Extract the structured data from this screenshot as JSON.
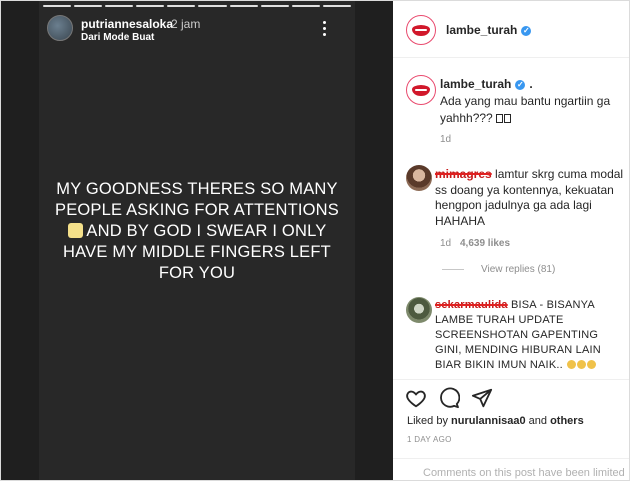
{
  "story": {
    "username": "putriannesaloka",
    "time": "2 jam",
    "subtitle": "Dari Mode Buat",
    "text_before": "MY GOODNESS THERES SO MANY PEOPLE ASKING FOR ATTENTIONS ",
    "text_after": " AND BY GOD I SWEAR I ONLY HAVE MY MIDDLE FINGERS LEFT FOR YOU",
    "emoji_icon": "face-icon",
    "progress_segments": 10
  },
  "post": {
    "header_username": "lambe_turah",
    "caption_username": "lambe_turah",
    "caption_dot": ".",
    "caption_text": "Ada yang mau bantu ngartiin ga yahhh??? ",
    "caption_time": "1d",
    "comments": [
      {
        "username": "mimagres",
        "text": " lamtur skrg cuma modal ss doang ya kontennya, kekuatan hengpon jadulnya ga ada lagi HAHAHA",
        "time": "1d",
        "likes": "4,639 likes"
      },
      {
        "username": "sekarmaulida",
        "text": " BISA - BISANYA LAMBE TURAH UPDATE SCREENSHOTAN GAPENTING GINI, MENDING HIBURAN LAIN BIAR BIKIN IMUN NAIK.. "
      }
    ],
    "view_replies": "View replies (81)",
    "liked_prefix": "Liked by ",
    "liked_user": "nurulannisaa0",
    "liked_and": " and ",
    "liked_others": "others",
    "timestamp": "1 DAY AGO",
    "comments_limited": "Comments on this post have been limited"
  },
  "colors": {
    "verified": "#3897f0",
    "story_bg": "#282828",
    "lips": "#d1182b"
  }
}
